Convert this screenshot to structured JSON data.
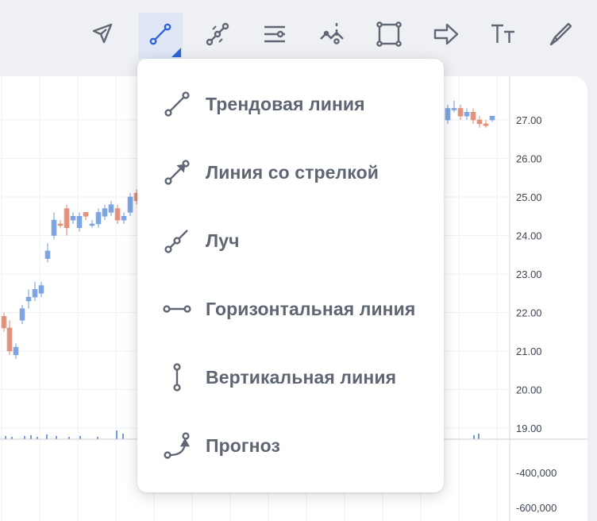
{
  "toolbar": {
    "tools": [
      {
        "id": "cursor",
        "icon": "cursor-arrow-icon"
      },
      {
        "id": "trend-line",
        "icon": "trend-line-icon",
        "active": true
      },
      {
        "id": "parallel-lines",
        "icon": "multi-point-line-icon"
      },
      {
        "id": "horizontal-levels",
        "icon": "horizontal-levels-icon"
      },
      {
        "id": "annotations",
        "icon": "pitchfork-icon"
      },
      {
        "id": "shapes",
        "icon": "rectangle-shape-icon"
      },
      {
        "id": "arrow",
        "icon": "arrow-icon"
      },
      {
        "id": "text",
        "icon": "text-tool-icon"
      },
      {
        "id": "brush",
        "icon": "brush-icon"
      }
    ],
    "active_color": "#2f63d8"
  },
  "menu": {
    "items": [
      {
        "label": "Трендовая линия",
        "icon": "trend-line-icon"
      },
      {
        "label": "Линия со стрелкой",
        "icon": "arrow-line-icon"
      },
      {
        "label": "Луч",
        "icon": "ray-icon"
      },
      {
        "label": "Горизонтальная линия",
        "icon": "horizontal-line-icon"
      },
      {
        "label": "Вертикальная линия",
        "icon": "vertical-line-icon"
      },
      {
        "label": "Прогноз",
        "icon": "forecast-icon"
      }
    ]
  },
  "price_axis": {
    "labels": [
      "27.00",
      "26.00",
      "25.00",
      "24.00",
      "23.00",
      "22.00",
      "21.00",
      "20.00",
      "19.00"
    ]
  },
  "volume_axis": {
    "labels": [
      "-400,000",
      "-600,000"
    ]
  },
  "colors": {
    "up_candle": "#6f9be0",
    "down_candle": "#e0856f",
    "grid": "#eef0f4"
  }
}
